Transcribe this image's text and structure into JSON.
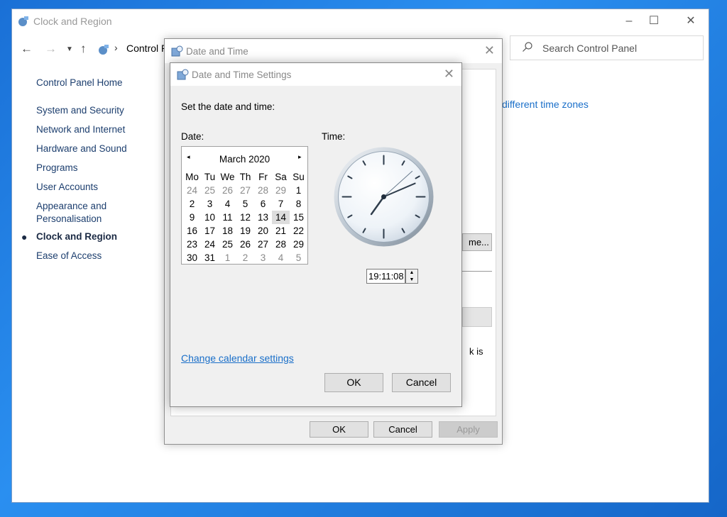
{
  "control_panel": {
    "title": "Clock and Region",
    "address": "Control P",
    "search_placeholder": "Search Control Panel",
    "sidebar": [
      {
        "label": "Control Panel Home"
      },
      {
        "label": "System and Security"
      },
      {
        "label": "Network and Internet"
      },
      {
        "label": "Hardware and Sound"
      },
      {
        "label": "Programs"
      },
      {
        "label": "User Accounts"
      },
      {
        "label": "Appearance and"
      },
      {
        "label": "Personalisation"
      },
      {
        "label": "Clock and Region"
      },
      {
        "label": "Ease of Access"
      }
    ],
    "content_link": "different time zones",
    "fragment_button": "me...",
    "fragment_text": "k is"
  },
  "date_time_dialog": {
    "title": "Date and Time",
    "ok": "OK",
    "cancel": "Cancel",
    "apply": "Apply"
  },
  "date_time_settings": {
    "title": "Date and Time Settings",
    "heading": "Set the date and time:",
    "date_label": "Date:",
    "time_label": "Time:",
    "calendar": {
      "month": "March 2020",
      "prev_arrow": "◂",
      "next_arrow": "▸",
      "weekdays": [
        "Mo",
        "Tu",
        "We",
        "Th",
        "Fr",
        "Sa",
        "Su"
      ],
      "weeks": [
        [
          "24",
          "25",
          "26",
          "27",
          "28",
          "29",
          "1"
        ],
        [
          "2",
          "3",
          "4",
          "5",
          "6",
          "7",
          "8"
        ],
        [
          "9",
          "10",
          "11",
          "12",
          "13",
          "14",
          "15"
        ],
        [
          "16",
          "17",
          "18",
          "19",
          "20",
          "21",
          "22"
        ],
        [
          "23",
          "24",
          "25",
          "26",
          "27",
          "28",
          "29"
        ],
        [
          "30",
          "31",
          "1",
          "2",
          "3",
          "4",
          "5"
        ]
      ],
      "selected": "14"
    },
    "time_value": "19:11:08",
    "change_calendar_link": "Change calendar settings",
    "ok": "OK",
    "cancel": "Cancel"
  }
}
